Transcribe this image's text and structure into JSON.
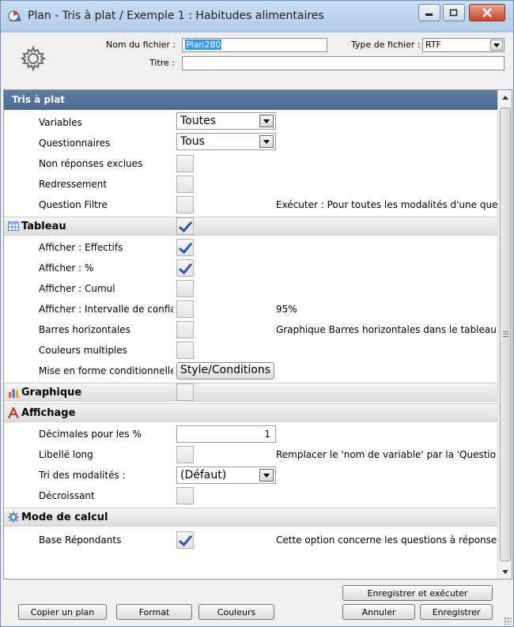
{
  "window": {
    "title": "Plan - Tris à plat / Exemple 1 : Habitudes alimentaires",
    "icon": "plan-icon"
  },
  "header": {
    "filename_label": "Nom du fichier :",
    "filename_value": "Plan280",
    "filetype_label": "Type de fichier :",
    "filetype_value": "RTF",
    "title_label": "Titre :",
    "title_value": ""
  },
  "grid": {
    "main_category": "Tris à plat",
    "general": {
      "variables_label": "Variables",
      "variables_value": "Toutes",
      "questionnaires_label": "Questionnaires",
      "questionnaires_value": "Tous",
      "non_reponses_label": "Non réponses exclues",
      "redressement_label": "Redressement",
      "question_filtre_label": "Question Filtre",
      "question_filtre_extra": "Exécuter : Pour toutes les modalités d'une que"
    },
    "tableau": {
      "label": "Tableau",
      "effectifs_label": "Afficher : Effectifs",
      "pct_label": "Afficher : %",
      "cumul_label": "Afficher : Cumul",
      "intervalle_label": "Afficher : Intervalle de confia",
      "intervalle_extra": "95%",
      "barres_label": "Barres horizontales",
      "barres_extra": "Graphique Barres horizontales dans le tableau",
      "couleurs_label": "Couleurs multiples",
      "mise_en_forme_label": "Mise en forme conditionnelle",
      "style_button": "Style/Conditions"
    },
    "graphique": {
      "label": "Graphique"
    },
    "affichage": {
      "label": "Affichage",
      "decimales_label": "Décimales pour les %",
      "decimales_value": "1",
      "libelle_label": "Libellé long",
      "libelle_extra": "Remplacer le 'nom de variable' par la 'Questio",
      "tri_label": "Tri des modalités :",
      "tri_value": "(Défaut)",
      "decroissant_label": "Décroissant"
    },
    "mode_calcul": {
      "label": "Mode de calcul",
      "base_label": "Base Répondants",
      "base_extra": "Cette option concerne les questions à réponse"
    },
    "checkbox_states": {
      "non_reponses": false,
      "redressement": false,
      "question_filtre": false,
      "tableau": true,
      "effectifs": true,
      "pct": true,
      "cumul": false,
      "intervalle": false,
      "barres": false,
      "couleurs": false,
      "graphique": false,
      "libelle": false,
      "decroissant": false,
      "base_repondants": true
    }
  },
  "footer": {
    "copier_plan": "Copier un plan",
    "format": "Format",
    "couleurs": "Couleurs",
    "enregistrer_executer": "Enregistrer et exécuter",
    "annuler": "Annuler",
    "enregistrer": "Enregistrer"
  },
  "colors": {
    "category_header": "#4b6890",
    "checkmark": "#2b56a8",
    "selection": "#3399ff"
  }
}
